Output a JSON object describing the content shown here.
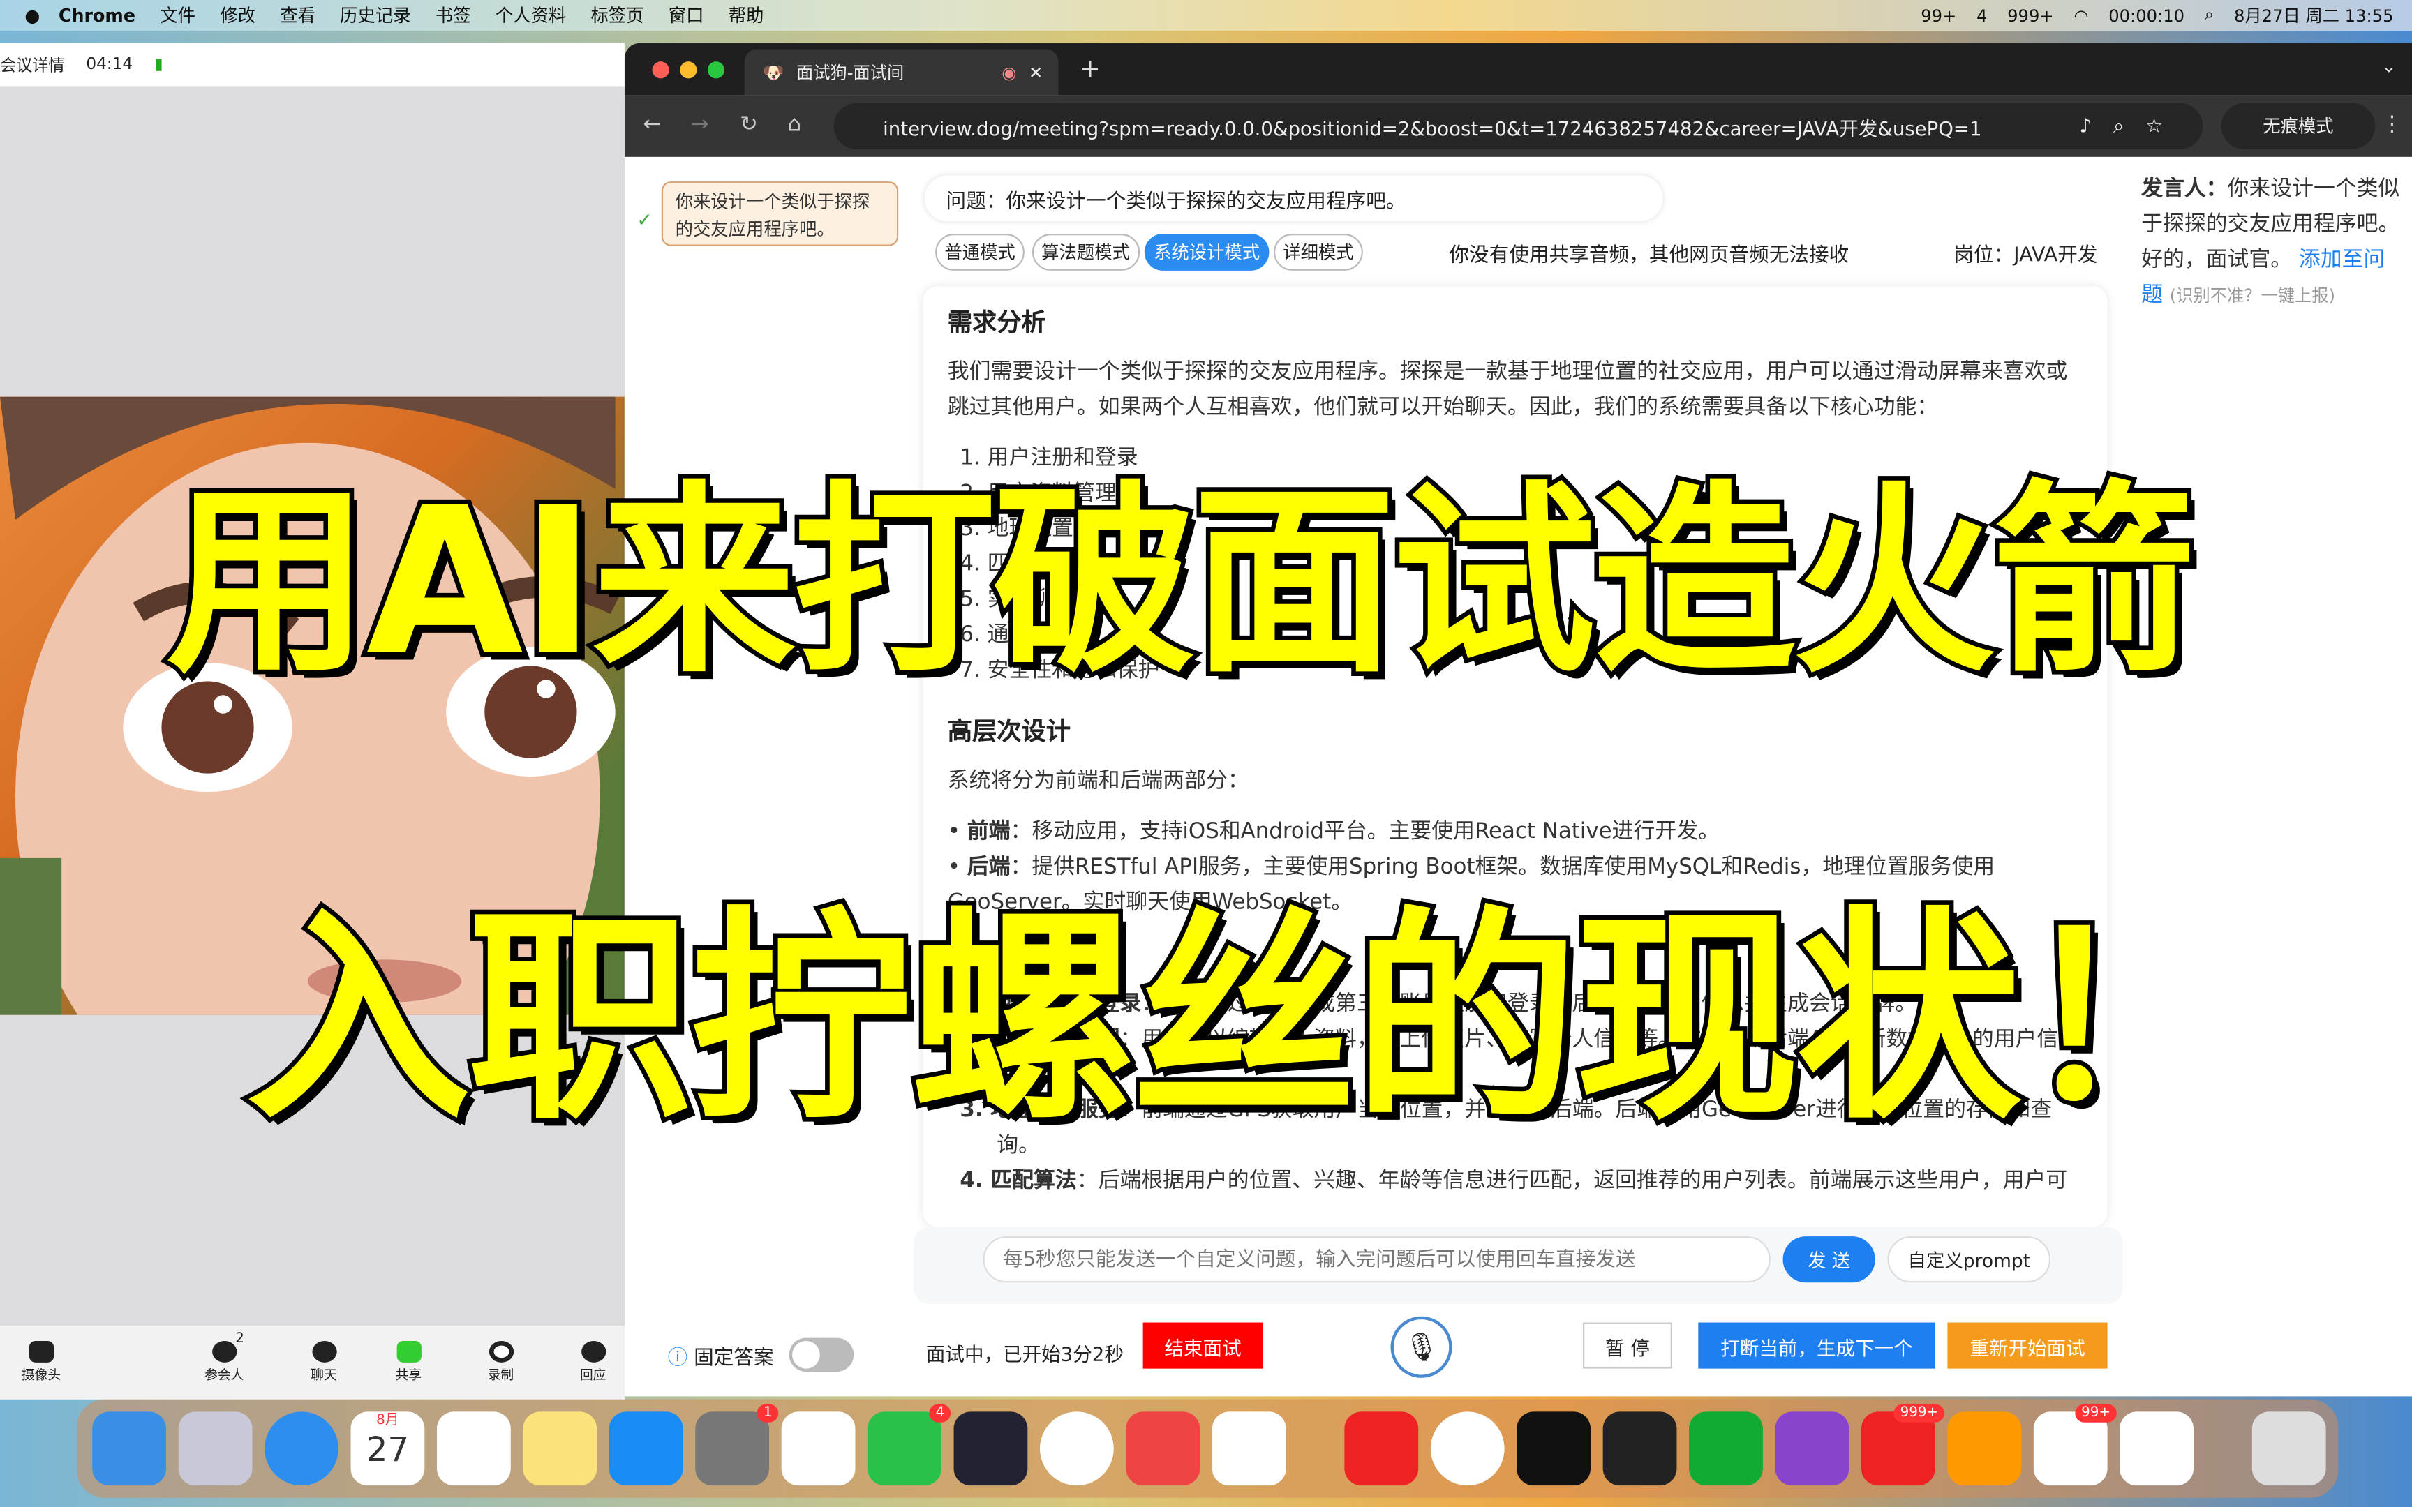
{
  "menubar": {
    "app": "Chrome",
    "items": [
      "文件",
      "修改",
      "查看",
      "历史记录",
      "书签",
      "个人资料",
      "标签页",
      "窗口",
      "帮助"
    ],
    "status": [
      "99+",
      "4",
      "999+",
      "00:00:10",
      "8月27日 周二 13:55"
    ]
  },
  "meeting": {
    "details": "会议详情",
    "time": "04:14",
    "tools": [
      "摄像头",
      "参会人",
      "聊天",
      "共享",
      "录制",
      "回应"
    ],
    "participants": "2"
  },
  "browser": {
    "tab_title": "面试狗-面试间",
    "url": "interview.dog/meeting?spm=ready.0.0.0&positionid=2&boost=0&t=1724638257482&career=JAVA开发&usePQ=1",
    "incognito": "无痕模式"
  },
  "page": {
    "history_question": "你来设计一个类似于探探的交友应用程序吧。",
    "question": "问题：你来设计一个类似于探探的交友应用程序吧。",
    "modes": [
      "普通模式",
      "算法题模式",
      "系统设计模式",
      "详细模式"
    ],
    "audio_notice": "你没有使用共享音频，其他网页音频无法接收",
    "position": "岗位：JAVA开发",
    "answer": {
      "h1": "需求分析",
      "p1": "我们需要设计一个类似于探探的交友应用程序。探探是一款基于地理位置的社交应用，用户可以通过滑动屏幕来喜欢或跳过其他用户。如果两个人互相喜欢，他们就可以开始聊天。因此，我们的系统需要具备以下核心功能：",
      "features": [
        "1. 用户注册和登录",
        "2. 用户资料管理",
        "3. 地理位置服务",
        "4. 匹配算法",
        "5. 实时聊天",
        "6. 通知系统",
        "7. 安全性和隐私保护"
      ],
      "h2": "高层次设计",
      "p2": "系统将分为前端和后端两部分：",
      "frontend_label": "前端",
      "frontend": "：移动应用，支持iOS和Android平台。主要使用React Native进行开发。",
      "backend_label": "后端",
      "backend": "：提供RESTful API服务，主要使用Spring Boot框架。数据库使用MySQL和Redis，地理位置服务使用GeoServer。实时聊天使用WebSocket。",
      "h3": "主要功能和流程",
      "flows": [
        {
          "label": "1. 用户注册和登录",
          "text": "：用户通过手机号或第三方账号注册和登录，后端验证用户信息并生成会话令牌。"
        },
        {
          "label": "2. 用户资料管理",
          "text": "：用户可以编辑个人资料，如上传照片、填写个人信息等。前端调用后端API更新数据库中的用户信息。"
        },
        {
          "label": "3. 地理位置服务",
          "text": "：前端通过GPS获取用户当前位置，并发送给后端。后端使用GeoServer进行用户位置的存储和查询。"
        },
        {
          "label": "4. 匹配算法",
          "text": "：后端根据用户的位置、兴趣、年龄等信息进行匹配，返回推荐的用户列表。前端展示这些用户，用户可"
        }
      ]
    },
    "input_placeholder": "每5秒您只能发送一个自定义问题，输入完问题后可以使用回车直接发送",
    "send": "发 送",
    "custom_prompt": "自定义prompt",
    "fixed_answer": "固定答案",
    "status": "面试中，已开始3分2秒",
    "end": "结束面试",
    "pause": "暂 停",
    "interrupt": "打断当前，生成下一个",
    "restart": "重新开始面试",
    "speaker_label": "发言人：",
    "speaker_text": "你来设计一个类似于探探的交友应用程序吧。好的，面试官。",
    "add_question": "添加至问题",
    "hint": "(识别不准？一键上报)"
  },
  "overlay": {
    "line1": "用AI来打破面试造火箭",
    "line2": "入职拧螺丝的现状！"
  },
  "dock": {
    "badges": [
      "1",
      "4",
      "999+",
      "99+"
    ],
    "calendar_month": "8月",
    "calendar_day": "27"
  },
  "colors": {
    "accent": "#1e7ff0",
    "danger": "#ff0000",
    "warning": "#f59a1b",
    "overlay_text": "#ffff00"
  }
}
